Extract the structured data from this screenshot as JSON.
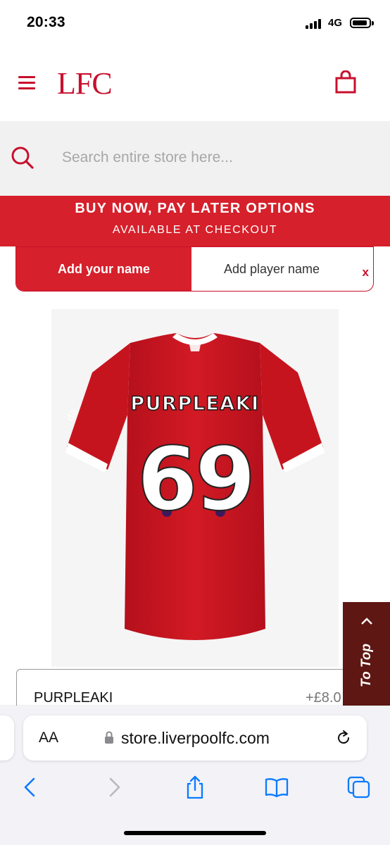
{
  "status_bar": {
    "time": "20:33",
    "network": "4G"
  },
  "header": {
    "logo": "LFC",
    "menu_icon": "hamburger-menu-icon",
    "bag_icon": "shopping-bag-icon"
  },
  "search": {
    "placeholder": "Search entire store here...",
    "icon": "search-icon"
  },
  "promo": {
    "line1": "BUY NOW, PAY LATER OPTIONS",
    "line2": "AVAILABLE AT CHECKOUT"
  },
  "name_tabs": {
    "active": "Add your name",
    "inactive": "Add player name",
    "close": "x"
  },
  "product": {
    "shirt_name": "PURPLEAKI",
    "shirt_number": "69"
  },
  "name_field": {
    "value": "PURPLEAKI",
    "price": "+£8.0"
  },
  "to_top": {
    "label": "To Top"
  },
  "browser": {
    "aa": "AA",
    "url": "store.liverpoolfc.com"
  },
  "colors": {
    "brand_red": "#c8102e",
    "promo_red": "#d6202b",
    "to_top_bg": "#5e1712",
    "ios_blue": "#0a7aff"
  }
}
